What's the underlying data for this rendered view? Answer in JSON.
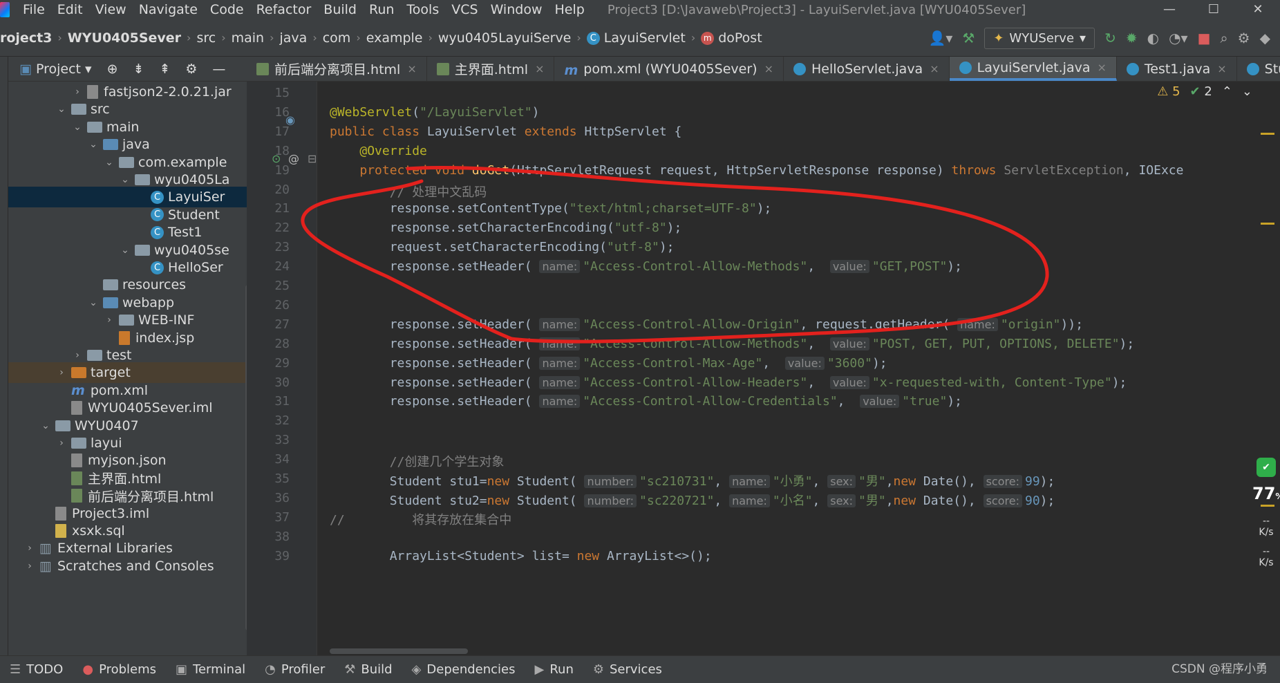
{
  "menu": [
    "File",
    "Edit",
    "View",
    "Navigate",
    "Code",
    "Refactor",
    "Build",
    "Run",
    "Tools",
    "VCS",
    "Window",
    "Help"
  ],
  "window_title": "Project3 [D:\\Javaweb\\Project3] - LayuiServlet.java [WYU0405Sever]",
  "window_controls": [
    "—",
    "☐",
    "✕"
  ],
  "breadcrumbs": [
    "roject3",
    "WYU0405Sever",
    "src",
    "main",
    "java",
    "com",
    "example",
    "wyu0405LayuiServe",
    "LayuiServlet",
    "doPost"
  ],
  "run_config": "WYUServe",
  "project_panel": {
    "title": "Project",
    "tree": [
      {
        "label": "fastjson2-2.0.21.jar",
        "type": "jar",
        "indent": 4,
        "arrow": "›"
      },
      {
        "label": "src",
        "type": "folder",
        "indent": 3,
        "arrow": "⌄"
      },
      {
        "label": "main",
        "type": "folder",
        "indent": 4,
        "arrow": "⌄"
      },
      {
        "label": "java",
        "type": "folder-blue",
        "indent": 5,
        "arrow": "⌄"
      },
      {
        "label": "com.example",
        "type": "folder",
        "indent": 6,
        "arrow": "⌄"
      },
      {
        "label": "wyu0405La",
        "type": "folder",
        "indent": 7,
        "arrow": "⌄"
      },
      {
        "label": "LayuiSer",
        "type": "class",
        "indent": 8,
        "arrow": "",
        "selected": true
      },
      {
        "label": "Student",
        "type": "class",
        "indent": 8,
        "arrow": ""
      },
      {
        "label": "Test1",
        "type": "class",
        "indent": 8,
        "arrow": ""
      },
      {
        "label": "wyu0405se",
        "type": "folder",
        "indent": 7,
        "arrow": "⌄"
      },
      {
        "label": "HelloSer",
        "type": "class",
        "indent": 8,
        "arrow": ""
      },
      {
        "label": "resources",
        "type": "folder",
        "indent": 5,
        "arrow": ""
      },
      {
        "label": "webapp",
        "type": "folder-blue",
        "indent": 5,
        "arrow": "⌄"
      },
      {
        "label": "WEB-INF",
        "type": "folder",
        "indent": 6,
        "arrow": "›"
      },
      {
        "label": "index.jsp",
        "type": "jsp",
        "indent": 6,
        "arrow": ""
      },
      {
        "label": "test",
        "type": "folder",
        "indent": 4,
        "arrow": "›"
      },
      {
        "label": "target",
        "type": "folder-orange",
        "indent": 3,
        "arrow": "›",
        "highlight": true
      },
      {
        "label": "pom.xml",
        "type": "maven",
        "indent": 3,
        "arrow": ""
      },
      {
        "label": "WYU0405Sever.iml",
        "type": "iml",
        "indent": 3,
        "arrow": ""
      },
      {
        "label": "WYU0407",
        "type": "folder",
        "indent": 2,
        "arrow": "⌄"
      },
      {
        "label": "layui",
        "type": "folder",
        "indent": 3,
        "arrow": "›"
      },
      {
        "label": "myjson.json",
        "type": "json",
        "indent": 3,
        "arrow": ""
      },
      {
        "label": "主界面.html",
        "type": "html",
        "indent": 3,
        "arrow": ""
      },
      {
        "label": "前后端分离项目.html",
        "type": "html",
        "indent": 3,
        "arrow": ""
      },
      {
        "label": "Project3.iml",
        "type": "iml",
        "indent": 2,
        "arrow": ""
      },
      {
        "label": "xsxk.sql",
        "type": "sql",
        "indent": 2,
        "arrow": ""
      },
      {
        "label": "External Libraries",
        "type": "lib",
        "indent": 1,
        "arrow": "›"
      },
      {
        "label": "Scratches and Consoles",
        "type": "lib",
        "indent": 1,
        "arrow": "›"
      }
    ]
  },
  "tabs": [
    {
      "label": "前后端分离项目.html",
      "icon": "html"
    },
    {
      "label": "主界面.html",
      "icon": "html"
    },
    {
      "label": "pom.xml (WYU0405Sever)",
      "icon": "maven"
    },
    {
      "label": "HelloServlet.java",
      "icon": "class"
    },
    {
      "label": "LayuiServlet.java",
      "icon": "class",
      "active": true
    },
    {
      "label": "Test1.java",
      "icon": "class"
    },
    {
      "label": "Student.ja",
      "icon": "class"
    }
  ],
  "inspections": {
    "warnings": "5",
    "ok": "2"
  },
  "line_numbers": [
    "15",
    "16",
    "17",
    "18",
    "19",
    "20",
    "21",
    "22",
    "23",
    "24",
    "25",
    "26",
    "27",
    "28",
    "29",
    "30",
    "31",
    "32",
    "33",
    "34",
    "35",
    "36",
    "37",
    "38",
    "39"
  ],
  "code_lines": [
    "",
    "<span class=\"ann\">@WebServlet</span>(<span class=\"str\">\"/LayuiServlet\"</span>)",
    "<span class=\"kw\">public class</span> LayuiServlet <span class=\"kw\">extends</span> HttpServlet {",
    "    <span class=\"ann\">@Override</span>",
    "    <span class=\"kw\">protected void</span> <span class=\"fn\">doGet</span>(HttpServletRequest request, HttpServletResponse response) <span class=\"kw\">throws</span> <span class=\"cm\">ServletException</span>, IOExce",
    "        <span class=\"cm\">// 处理中文乱码</span>",
    "        response.setContentType(<span class=\"str\">\"text/html;charset=UTF-8\"</span>);",
    "        response.setCharacterEncoding(<span class=\"str\">\"utf-8\"</span>);",
    "        request.setCharacterEncoding(<span class=\"str\">\"utf-8\"</span>);",
    "        response.setHeader( <span class=\"hint\">name:</span><span class=\"str\">\"Access-Control-Allow-Methods\"</span>,  <span class=\"hint\">value:</span><span class=\"str\">\"GET,POST\"</span>);",
    "",
    "",
    "        response.setHeader( <span class=\"hint\">name:</span><span class=\"str\">\"Access-Control-Allow-Origin\"</span>, request.getHeader( <span class=\"hint\">name:</span><span class=\"str\">\"origin\"</span>));",
    "        response.setHeader( <span class=\"hint\">name:</span><span class=\"str\">\"Access-Control-Allow-Methods\"</span>,  <span class=\"hint\">value:</span><span class=\"str\">\"POST, GET, PUT, OPTIONS, DELETE\"</span>);",
    "        response.setHeader( <span class=\"hint\">name:</span><span class=\"str\">\"Access-Control-Max-Age\"</span>,  <span class=\"hint\">value:</span><span class=\"str\">\"3600\"</span>);",
    "        response.setHeader( <span class=\"hint\">name:</span><span class=\"str\">\"Access-Control-Allow-Headers\"</span>,  <span class=\"hint\">value:</span><span class=\"str\">\"x-requested-with, Content-Type\"</span>);",
    "        response.setHeader( <span class=\"hint\">name:</span><span class=\"str\">\"Access-Control-Allow-Credentials\"</span>,  <span class=\"hint\">value:</span><span class=\"str\">\"true\"</span>);",
    "",
    "",
    "        <span class=\"cm\">//创建几个学生对象</span>",
    "        Student stu1=<span class=\"kw\">new</span> Student( <span class=\"hint\">number:</span><span class=\"str\">\"sc210731\"</span>, <span class=\"hint\">name:</span><span class=\"str\">\"小勇\"</span>, <span class=\"hint\">sex:</span><span class=\"str\">\"男\"</span>,<span class=\"kw\">new</span> Date(), <span class=\"hint\">score:</span><span class=\"num\">99</span>);",
    "        Student stu2=<span class=\"kw\">new</span> Student( <span class=\"hint\">number:</span><span class=\"str\">\"sc220721\"</span>, <span class=\"hint\">name:</span><span class=\"str\">\"小名\"</span>, <span class=\"hint\">sex:</span><span class=\"str\">\"男\"</span>,<span class=\"kw\">new</span> Date(), <span class=\"hint\">score:</span><span class=\"num\">90</span>);",
    "<span class=\"cm\">//         将其存放在集合中</span>",
    "",
    "        ArrayList&lt;Student&gt; list= <span class=\"kw\">new</span> ArrayList&lt;&gt;();"
  ],
  "right_panel": {
    "percent": "77",
    "unit": "%",
    "up": "--",
    "up_unit": "K/s",
    "down": "--",
    "down_unit": "K/s"
  },
  "status_bar": [
    {
      "label": "TODO",
      "icon": "☰"
    },
    {
      "label": "Problems",
      "icon": "●"
    },
    {
      "label": "Terminal",
      "icon": "▣"
    },
    {
      "label": "Profiler",
      "icon": "◔"
    },
    {
      "label": "Build",
      "icon": "⚒"
    },
    {
      "label": "Dependencies",
      "icon": "◈"
    },
    {
      "label": "Run",
      "icon": "▶"
    },
    {
      "label": "Services",
      "icon": "⚙"
    }
  ],
  "watermark": "CSDN @程序小勇",
  "colors": {
    "annotation_red": "#e3211d",
    "accent": "#4a88c7"
  }
}
